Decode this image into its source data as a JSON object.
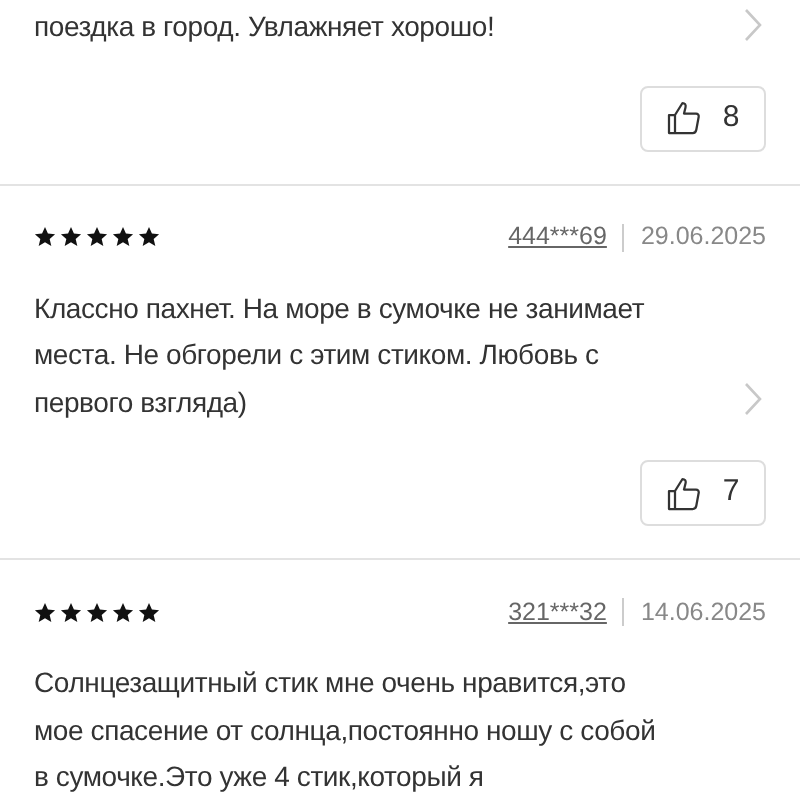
{
  "reviews": [
    {
      "text": "поездка в город. Увлажняет хорошо!",
      "likes": "8"
    },
    {
      "stars": 5,
      "author": "444***69",
      "date": "29.06.2025",
      "text": "Классно пахнет. На море в сумочке не занимает места. Не обгорели с этим стиком. Любовь с первого взгляда)",
      "likes": "7"
    },
    {
      "stars": 5,
      "author": "321***32",
      "date": "14.06.2025",
      "text": "Солнцезащитный стик мне очень нравится,это мое спасение от солнца,постоянно ношу с собой в сумочке.Это уже 4 стик,который я"
    }
  ]
}
